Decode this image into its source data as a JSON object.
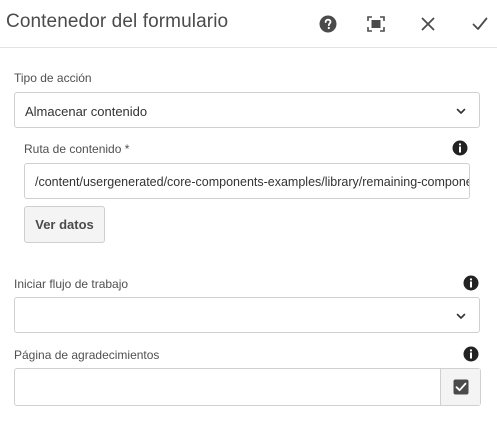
{
  "header": {
    "title": "Contenedor del formulario",
    "icons": [
      "help-icon",
      "fullscreen-icon",
      "close-icon",
      "checkmark-icon"
    ]
  },
  "action_type": {
    "label": "Tipo de acción",
    "selected": "Almacenar contenido",
    "icon": "chevron-down-icon"
  },
  "content_path": {
    "label": "Ruta de contenido *",
    "value": "/content/usergenerated/core-components-examples/library/remaining-components",
    "info_icon": "info-icon"
  },
  "view_data": {
    "label": "Ver datos"
  },
  "workflow": {
    "label": "Iniciar flujo de trabajo",
    "selected": "",
    "info_icon": "info-icon",
    "icon": "chevron-down-icon"
  },
  "thank_you_page": {
    "label": "Página de agradecimientos",
    "value": "",
    "info_icon": "info-icon",
    "picker_icon": "check-square-icon"
  },
  "colors": {
    "text": "#4b4b4b",
    "border": "#d0d0d0",
    "button_bg": "#f4f4f4",
    "icon": "#3a3a3a"
  }
}
